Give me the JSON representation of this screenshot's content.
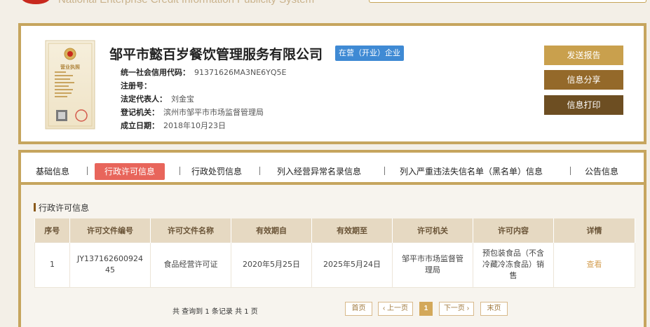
{
  "header": {
    "system_title": "National Enterprise Credit Information Publicity System"
  },
  "company": {
    "name": "邹平市懿百岁餐饮管理服务有限公司",
    "status": "在营（开业）企业",
    "fields": [
      {
        "label": "统一社会信用代码：",
        "value": "91371626MA3NE6YQ5E"
      },
      {
        "label": "注册号：",
        "value": ""
      },
      {
        "label": "法定代表人：",
        "value": "刘金宝"
      },
      {
        "label": "登记机关：",
        "value": "滨州市邹平市市场监督管理局"
      },
      {
        "label": "成立日期：",
        "value": "2018年10月23日"
      }
    ],
    "license_image_title": "营业执照"
  },
  "actions": {
    "report": "发送报告",
    "share": "信息分享",
    "print": "信息打印"
  },
  "tabs": [
    {
      "label": "基础信息",
      "active": false
    },
    {
      "label": "行政许可信息",
      "active": true
    },
    {
      "label": "行政处罚信息",
      "active": false
    },
    {
      "label": "列入经营异常名录信息",
      "active": false
    },
    {
      "label": "列入严重违法失信名单（黑名单）信息",
      "active": false
    },
    {
      "label": "公告信息",
      "active": false
    }
  ],
  "section_title": "行政许可信息",
  "table": {
    "headers": [
      "序号",
      "许可文件编号",
      "许可文件名称",
      "有效期自",
      "有效期至",
      "许可机关",
      "许可内容",
      "详情"
    ],
    "rows": [
      [
        "1",
        "JY13716260092445",
        "食品经营许可证",
        "2020年5月25日",
        "2025年5月24日",
        "邹平市市场监督管理局",
        "预包装食品（不含冷藏冷冻食品）销售",
        "查看"
      ]
    ]
  },
  "pagination": {
    "summary": "共 查询到 1 条记录 共 1 页",
    "first": "首页",
    "prev": "‹ 上一页",
    "current": "1",
    "next": "下一页 ›",
    "last": "末页"
  },
  "colors": {
    "gold_border": "#c6a55e",
    "status_blue": "#3f8ad4",
    "active_tab": "#e8655b",
    "btn_report": "#c9a04d",
    "btn_share": "#94692a",
    "btn_print": "#6d4e22"
  }
}
